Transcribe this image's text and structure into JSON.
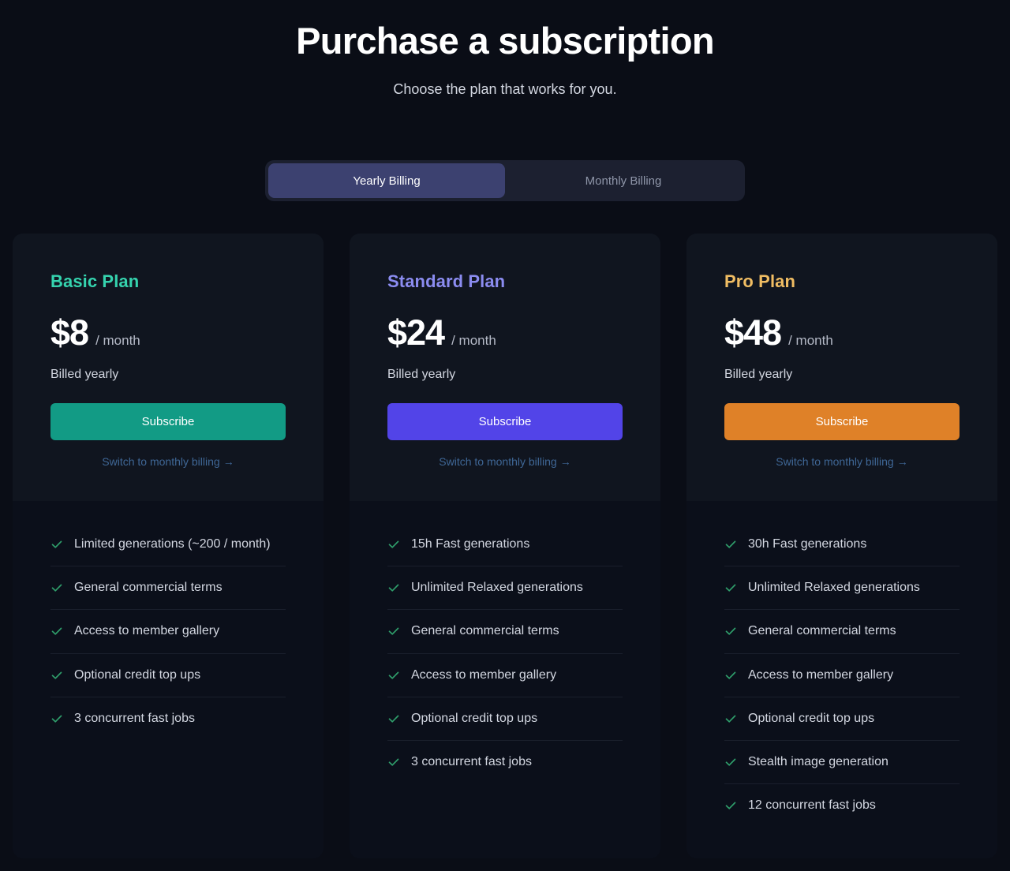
{
  "header": {
    "title": "Purchase a subscription",
    "subtitle": "Choose the plan that works for you."
  },
  "billing_toggle": {
    "options": [
      {
        "label": "Yearly Billing",
        "active": true
      },
      {
        "label": "Monthly Billing",
        "active": false
      }
    ]
  },
  "colors": {
    "page_background": "#0a0d16",
    "card_background": "#0d111c",
    "card_header_background": "#10151f",
    "toggle_background": "#1c2030",
    "toggle_active_background": "#3c4170",
    "basic_accent": "#35d3ae",
    "standard_accent": "#8b8cf0",
    "pro_accent": "#f0bd63",
    "basic_button": "#129b85",
    "standard_button": "#5244e8",
    "pro_button": "#df8128",
    "check_icon": "#2f9e6b",
    "link": "#3f6796"
  },
  "plans": [
    {
      "name": "Basic Plan",
      "price": "$8",
      "period": "/ month",
      "billing_note": "Billed yearly",
      "subscribe_label": "Subscribe",
      "switch_label": "Switch to monthly billing",
      "switch_arrow": "→",
      "features": [
        "Limited generations (~200 / month)",
        "General commercial terms",
        "Access to member gallery",
        "Optional credit top ups",
        "3 concurrent fast jobs"
      ]
    },
    {
      "name": "Standard Plan",
      "price": "$24",
      "period": "/ month",
      "billing_note": "Billed yearly",
      "subscribe_label": "Subscribe",
      "switch_label": "Switch to monthly billing",
      "switch_arrow": "→",
      "features": [
        "15h Fast generations",
        "Unlimited Relaxed generations",
        "General commercial terms",
        "Access to member gallery",
        "Optional credit top ups",
        "3 concurrent fast jobs"
      ]
    },
    {
      "name": "Pro Plan",
      "price": "$48",
      "period": "/ month",
      "billing_note": "Billed yearly",
      "subscribe_label": "Subscribe",
      "switch_label": "Switch to monthly billing",
      "switch_arrow": "→",
      "features": [
        "30h Fast generations",
        "Unlimited Relaxed generations",
        "General commercial terms",
        "Access to member gallery",
        "Optional credit top ups",
        "Stealth image generation",
        "12 concurrent fast jobs"
      ]
    }
  ]
}
